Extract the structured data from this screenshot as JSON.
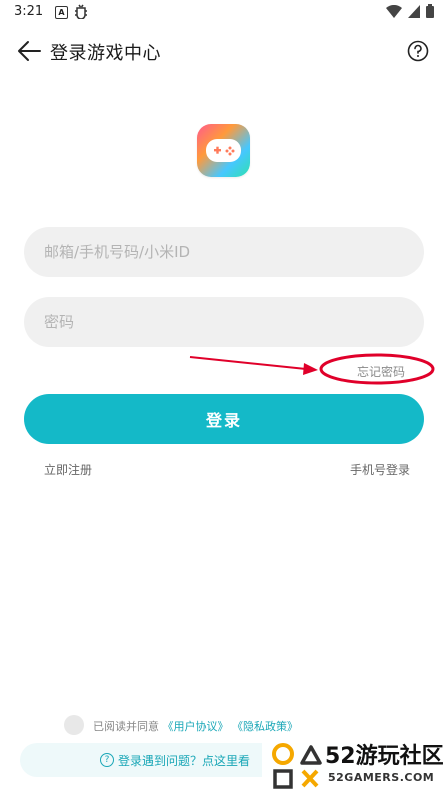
{
  "status_bar": {
    "time": "3:21",
    "notif_a": "A"
  },
  "header": {
    "title": "登录游戏中心"
  },
  "form": {
    "account_placeholder": "邮箱/手机号码/小米ID",
    "password_placeholder": "密码",
    "forgot_password": "忘记密码",
    "login_button": "登录",
    "register_link": "立即注册",
    "phone_login_link": "手机号登录"
  },
  "agreement": {
    "prefix": "已阅读并同意",
    "user_agreement": "《用户协议》",
    "privacy_policy": "《隐私政策》"
  },
  "help_bar": {
    "text": "登录遇到问题？点这里看"
  },
  "watermark": {
    "brand": "52游玩社区",
    "site": "52GAMERS.COM"
  },
  "colors": {
    "accent": "#14b9c8",
    "link": "#1aa7b7",
    "annotation": "#e0002a"
  }
}
